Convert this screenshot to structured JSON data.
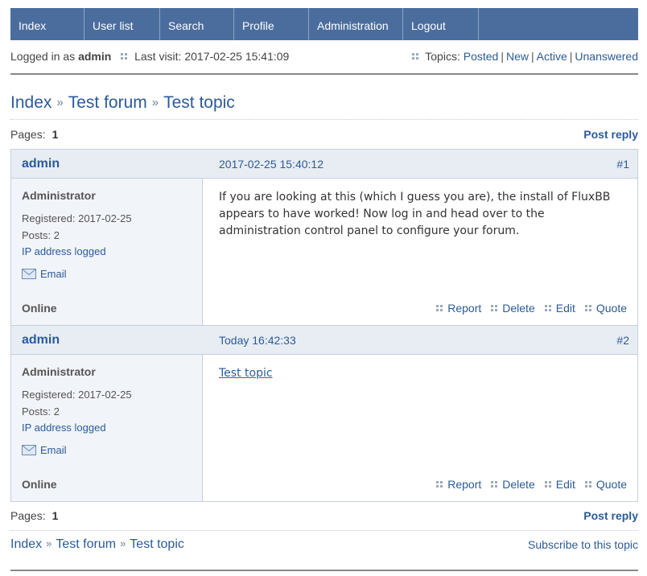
{
  "nav": {
    "items": [
      "Index",
      "User list",
      "Search",
      "Profile",
      "Administration",
      "Logout"
    ]
  },
  "status": {
    "logged_in_prefix": "Logged in as",
    "username": "admin",
    "last_visit": "Last visit: 2017-02-25 15:41:09",
    "topics_label": "Topics:",
    "topic_links": [
      "Posted",
      "New",
      "Active",
      "Unanswered"
    ]
  },
  "breadcrumb": [
    "Index",
    "Test forum",
    "Test topic"
  ],
  "pagination": {
    "label": "Pages:",
    "current": "1",
    "post_reply": "Post reply"
  },
  "posts": [
    {
      "author": "admin",
      "date": "2017-02-25 15:40:12",
      "number": "#1",
      "title": "Administrator",
      "registered": "Registered: 2017-02-25",
      "posts": "Posts: 2",
      "ip": "IP address logged",
      "email": "Email",
      "online": "Online",
      "message": "If you are looking at this (which I guess you are), the install of FluxBB appears to have worked! Now log in and head over to the administration control panel to configure your forum."
    },
    {
      "author": "admin",
      "date": "Today 16:42:33",
      "number": "#2",
      "title": "Administrator",
      "registered": "Registered: 2017-02-25",
      "posts": "Posts: 2",
      "ip": "IP address logged",
      "email": "Email",
      "online": "Online",
      "message_link": "Test topic"
    }
  ],
  "post_actions": [
    "Report",
    "Delete",
    "Edit",
    "Quote"
  ],
  "footer": {
    "subscribe": "Subscribe to this topic"
  },
  "colors": {
    "nav_bg": "#4b6d9e",
    "link": "#2a5b9b",
    "post_header_bg": "#e8edf3",
    "sidebar_bg": "#f1f4f8"
  }
}
